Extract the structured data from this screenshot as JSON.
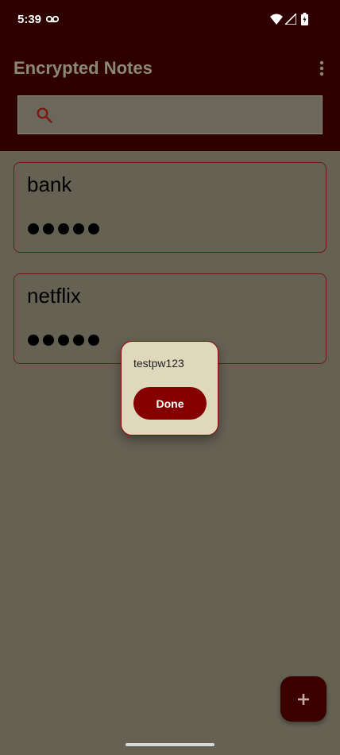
{
  "status_bar": {
    "time": "5:39",
    "icons": [
      "voicemail-icon",
      "wifi-icon",
      "cellular-signal-icon",
      "battery-charging-icon"
    ]
  },
  "app_bar": {
    "title": "Encrypted Notes",
    "menu_icon": "more-vertical-icon"
  },
  "search": {
    "icon": "search-icon",
    "value": "",
    "placeholder": ""
  },
  "notes": [
    {
      "title": "bank",
      "masked_value": "●●●●●"
    },
    {
      "title": "netflix",
      "masked_value": "●●●●●"
    }
  ],
  "dialog": {
    "text": "testpw123",
    "button_label": "Done"
  },
  "fab": {
    "icon": "plus-icon"
  },
  "colors": {
    "app_bar": "#2e0000",
    "background": "#656153",
    "accent": "#850000",
    "dialog_background": "#dfd8bd"
  }
}
